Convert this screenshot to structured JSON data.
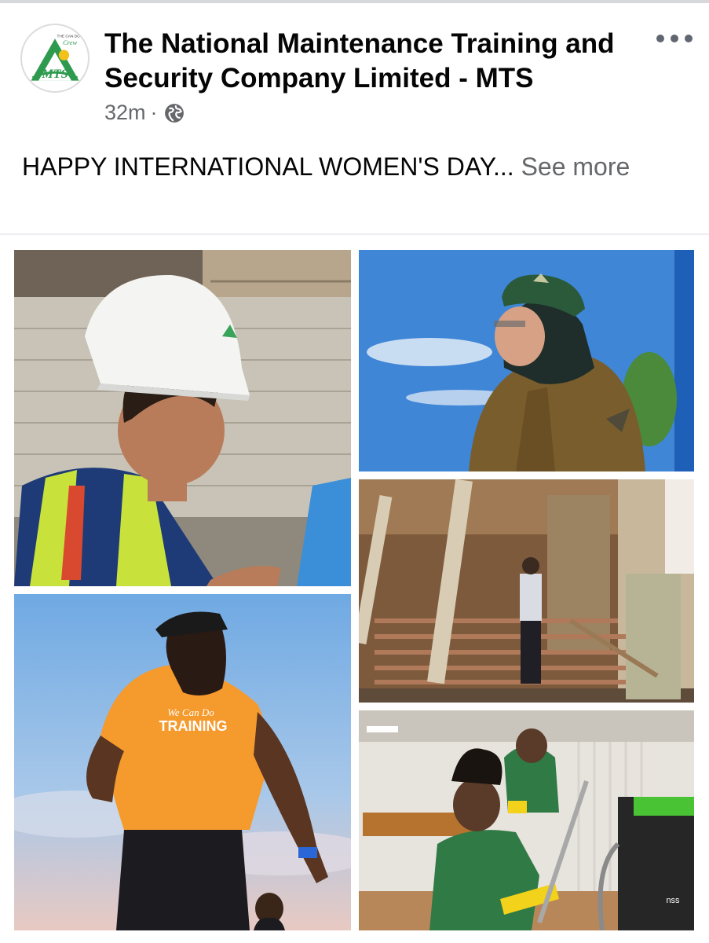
{
  "post": {
    "author": "The National Maintenance Training and Security Company Limited - MTS",
    "time": "32m",
    "separator": "·",
    "privacy_icon": "globe-icon",
    "more_icon": "more-options-icon",
    "text": "HAPPY INTERNATIONAL WOMEN'S DAY...",
    "see_more": " See more"
  },
  "logo": {
    "top_text": "THE CAN DO",
    "script_text": "Crew",
    "mark_text": "MTS"
  },
  "photos": [
    {
      "name": "photo-construction-worker"
    },
    {
      "name": "photo-security-officer"
    },
    {
      "name": "photo-building-staircase"
    },
    {
      "name": "photo-runner-orange-shirt",
      "shirt_text_top": "We Can Do",
      "shirt_text": "TRAINING"
    },
    {
      "name": "photo-cleaning-crew",
      "machine_label": "nss"
    }
  ],
  "colors": {
    "text_primary": "#050505",
    "text_secondary": "#65676b",
    "logo_green": "#2e9a4e",
    "sky_blue": "#3f86d6",
    "orange_shirt": "#f59a2c",
    "uniform_green": "#2f7a45"
  }
}
